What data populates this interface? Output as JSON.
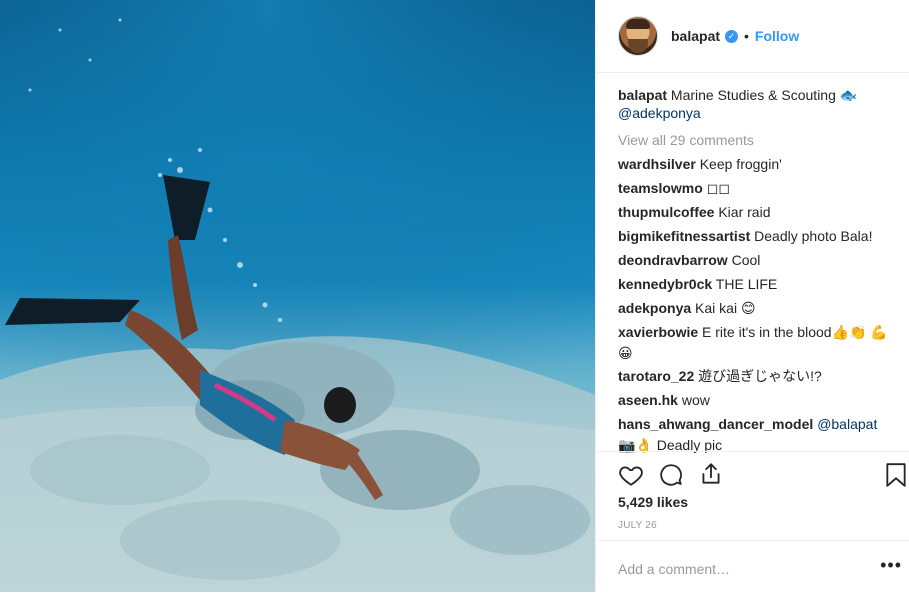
{
  "post": {
    "username": "balapat",
    "follow_label": "Follow",
    "dot": "•",
    "verified_glyph": "✓"
  },
  "caption": {
    "user": "balapat",
    "text": " Marine Studies & Scouting 🐟",
    "mention": "@adekponya"
  },
  "view_all": "View all 29 comments",
  "comments": [
    {
      "user": "wardhsilver",
      "text": " Keep froggin'"
    },
    {
      "user": "teamslowmo",
      "text": " ◻◻"
    },
    {
      "user": "thupmulcoffee",
      "text": " Kiar raid"
    },
    {
      "user": "bigmikefitnessartist",
      "text": " Deadly photo Bala!"
    },
    {
      "user": "deondravbarrow",
      "text": " Cool"
    },
    {
      "user": "kennedybr0ck",
      "text": " THE LIFE"
    },
    {
      "user": "adekponya",
      "text": " Kai kai 😊"
    },
    {
      "user": "xavierbowie",
      "text": " E rite it's in the blood👍👏 💪😀"
    },
    {
      "user": "tarotaro_22",
      "text": " 遊び過ぎじゃない!?"
    },
    {
      "user": "aseen.hk",
      "text": " wow"
    },
    {
      "user": "hans_ahwang_dancer_model",
      "text": " ",
      "mention": "@balapat",
      "text2": "📷👌 Deadly pic"
    }
  ],
  "likes": "5,429 likes",
  "date": "JULY 26",
  "add_comment_placeholder": "Add a comment…",
  "more_label": "•••",
  "icons": {
    "like": "heart-icon",
    "comment": "comment-bubble-icon",
    "share": "share-icon",
    "save": "bookmark-icon"
  },
  "colors": {
    "link": "#3897f0",
    "muted": "#999999",
    "text": "#262626"
  }
}
